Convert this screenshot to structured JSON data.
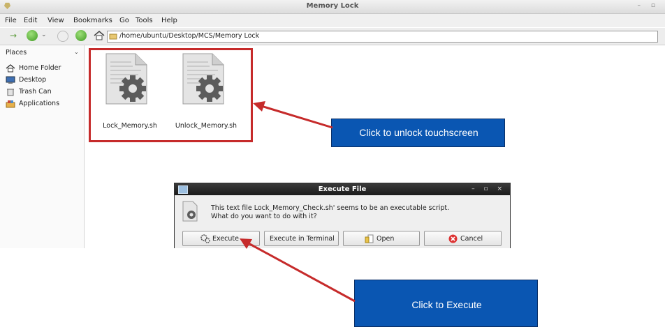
{
  "window": {
    "title": "Memory Lock"
  },
  "menu": {
    "items": [
      "File",
      "Edit",
      "View",
      "Bookmarks",
      "Go",
      "Tools",
      "Help"
    ]
  },
  "location": {
    "path": "/home/ubuntu/Desktop/MCS/Memory Lock"
  },
  "sidebar": {
    "header": "Places",
    "items": [
      {
        "label": "Home Folder",
        "icon": "home-icon"
      },
      {
        "label": "Desktop",
        "icon": "desktop-icon"
      },
      {
        "label": "Trash Can",
        "icon": "trash-icon"
      },
      {
        "label": "Applications",
        "icon": "applications-icon"
      }
    ]
  },
  "files": [
    {
      "name": "Lock_Memory.sh",
      "icon": "script-file-icon"
    },
    {
      "name": "Unlock_Memory.sh",
      "icon": "script-file-icon"
    }
  ],
  "dialog": {
    "title": "Execute File",
    "message_line1": "This text file Lock_Memory_Check.sh' seems to be an executable script.",
    "message_line2": "What do you want to do with it?",
    "buttons": {
      "execute": "Execute",
      "execute_terminal": "Execute in Terminal",
      "open": "Open",
      "cancel": "Cancel"
    }
  },
  "callouts": {
    "unlock": "Click to unlock touchscreen",
    "execute": "Click to Execute"
  },
  "colors": {
    "highlight_red": "#c62b2b",
    "callout_blue": "#0a56b2",
    "dialog_titlebar": "#222222"
  }
}
